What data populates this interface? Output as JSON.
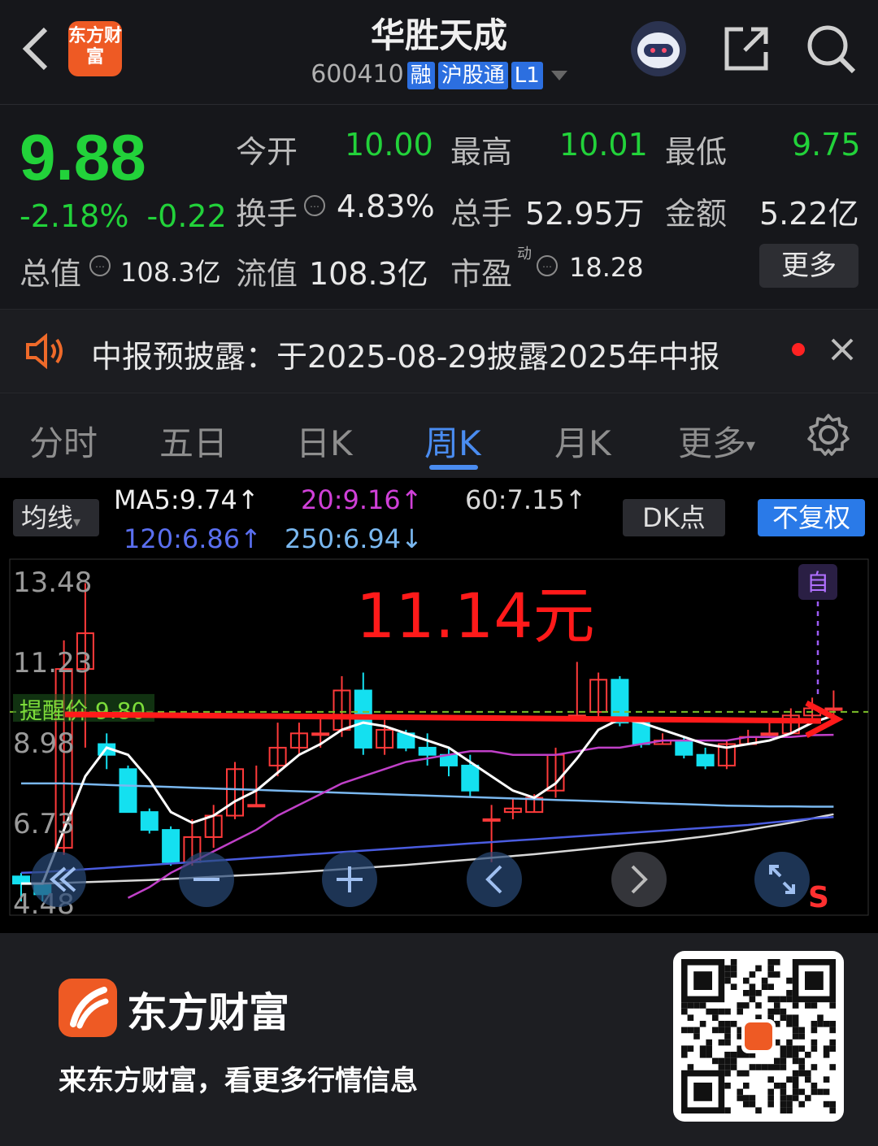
{
  "header": {
    "title": "华胜天成",
    "code": "600410",
    "tags": [
      "融",
      "沪股通",
      "L1"
    ],
    "logo_text": "东方财富"
  },
  "quote": {
    "price": "9.88",
    "change_pct": "-2.18%",
    "change": "-0.22",
    "open_label": "今开",
    "open": "10.00",
    "high_label": "最高",
    "high": "10.01",
    "low_label": "最低",
    "low": "9.75",
    "turnover_label": "换手",
    "turnover": "4.83%",
    "volume_label": "总手",
    "volume": "52.95万",
    "amount_label": "金额",
    "amount": "5.22亿",
    "mktcap_label": "总值",
    "mktcap": "108.3亿",
    "float_label": "流值",
    "float": "108.3亿",
    "pe_label": "市盈",
    "pe_sup": "动",
    "pe": "18.28",
    "more": "更多",
    "up_color": "#ff3030",
    "down_color": "#22d23a"
  },
  "notice": {
    "text": "中报预披露：于2025-08-29披露2025年中报"
  },
  "tabs": [
    "分时",
    "五日",
    "日K",
    "周K",
    "月K",
    "更多"
  ],
  "active_tab": "周K",
  "chart_toolbar": {
    "ma_button": "均线",
    "ma5": "MA5:9.74↑",
    "ma20": "20:9.16↑",
    "ma60": "60:7.15↑",
    "ma120": "120:6.86↑",
    "ma250": "250:6.94↓",
    "dk_button": "DK点",
    "adjust_button": "不复权"
  },
  "chart_data": {
    "type": "candlestick",
    "y_ticks": [
      "13.48",
      "11.23",
      "8.98",
      "6.73",
      "4.48"
    ],
    "ylim": [
      4.48,
      13.48
    ],
    "alert_label": "提醒价 9.80",
    "alert_price": 9.8,
    "annotation": "11.14元",
    "annotation_price": 11.14,
    "self_marker": "自",
    "sell_marker": "S",
    "candles": [
      [
        5.2,
        5.0,
        4.5,
        5.3
      ],
      [
        5.0,
        4.7,
        4.5,
        5.1
      ],
      [
        6.0,
        11.0,
        5.8,
        11.8
      ],
      [
        11.0,
        12.0,
        8.8,
        13.4
      ],
      [
        8.9,
        8.6,
        8.2,
        9.2
      ],
      [
        8.2,
        7.0,
        7.0,
        8.3
      ],
      [
        7.0,
        6.5,
        6.4,
        7.1
      ],
      [
        6.5,
        5.6,
        5.5,
        6.6
      ],
      [
        5.6,
        6.3,
        5.5,
        6.8
      ],
      [
        6.3,
        6.9,
        6.0,
        7.2
      ],
      [
        6.9,
        8.2,
        6.8,
        8.4
      ],
      [
        7.2,
        7.2,
        7.2,
        8.3
      ],
      [
        8.3,
        8.8,
        8.0,
        9.5
      ],
      [
        8.8,
        9.2,
        8.6,
        9.5
      ],
      [
        9.2,
        9.2,
        8.8,
        9.6
      ],
      [
        9.3,
        10.4,
        9.1,
        10.8
      ],
      [
        10.4,
        8.8,
        8.6,
        10.9
      ],
      [
        8.8,
        9.3,
        8.6,
        9.7
      ],
      [
        9.2,
        8.8,
        8.7,
        9.3
      ],
      [
        8.8,
        8.6,
        8.3,
        9.2
      ],
      [
        8.6,
        8.3,
        8.0,
        8.8
      ],
      [
        8.3,
        7.6,
        7.4,
        8.6
      ],
      [
        6.8,
        6.8,
        5.6,
        7.2
      ],
      [
        7.0,
        7.1,
        6.8,
        7.4
      ],
      [
        7.0,
        7.4,
        7.0,
        7.5
      ],
      [
        7.6,
        8.6,
        7.4,
        8.8
      ],
      [
        9.7,
        9.7,
        9.7,
        11.2
      ],
      [
        9.8,
        10.7,
        9.6,
        10.9
      ],
      [
        10.7,
        9.5,
        9.4,
        10.8
      ],
      [
        9.5,
        8.9,
        8.8,
        9.6
      ],
      [
        8.9,
        9.0,
        8.9,
        9.2
      ],
      [
        9.0,
        8.6,
        8.5,
        9.1
      ],
      [
        8.6,
        8.3,
        8.2,
        8.8
      ],
      [
        8.3,
        8.9,
        8.2,
        9.0
      ],
      [
        8.9,
        9.1,
        8.9,
        9.3
      ],
      [
        9.2,
        9.2,
        9.1,
        9.5
      ],
      [
        9.2,
        9.7,
        9.2,
        9.9
      ],
      [
        9.7,
        9.9,
        9.6,
        10.2
      ],
      [
        9.9,
        9.9,
        9.7,
        10.4
      ]
    ],
    "ma5": [
      5.0,
      5.0,
      6.5,
      8.0,
      8.8,
      8.6,
      7.9,
      7.0,
      6.7,
      6.9,
      7.3,
      7.6,
      8.1,
      8.6,
      8.9,
      9.3,
      9.5,
      9.4,
      9.2,
      9.0,
      8.8,
      8.4,
      8.0,
      7.6,
      7.4,
      7.8,
      8.5,
      9.3,
      9.6,
      9.5,
      9.3,
      9.1,
      8.9,
      8.8,
      8.9,
      9.0,
      9.2,
      9.5,
      9.7
    ],
    "ma20": [
      null,
      null,
      null,
      null,
      null,
      4.6,
      4.9,
      5.3,
      5.6,
      5.9,
      6.2,
      6.5,
      6.9,
      7.2,
      7.5,
      7.8,
      8.0,
      8.2,
      8.4,
      8.5,
      8.6,
      8.7,
      8.7,
      8.6,
      8.6,
      8.6,
      8.7,
      8.8,
      8.8,
      8.9,
      9.0,
      9.0,
      9.0,
      9.0,
      9.1,
      9.1,
      9.1,
      9.15,
      9.16
    ],
    "ma60": [
      7.8,
      7.8,
      7.8,
      7.78,
      7.76,
      7.74,
      7.72,
      7.7,
      7.68,
      7.66,
      7.64,
      7.62,
      7.6,
      7.58,
      7.56,
      7.54,
      7.52,
      7.5,
      7.48,
      7.46,
      7.44,
      7.42,
      7.4,
      7.38,
      7.36,
      7.34,
      7.32,
      7.3,
      7.28,
      7.26,
      7.24,
      7.22,
      7.2,
      7.18,
      7.17,
      7.16,
      7.16,
      7.15,
      7.15
    ],
    "ma120": [
      5.3,
      5.32,
      5.36,
      5.4,
      5.44,
      5.48,
      5.52,
      5.56,
      5.6,
      5.64,
      5.68,
      5.72,
      5.76,
      5.8,
      5.84,
      5.88,
      5.92,
      5.96,
      6.0,
      6.04,
      6.08,
      6.12,
      6.16,
      6.2,
      6.24,
      6.28,
      6.32,
      6.36,
      6.4,
      6.44,
      6.48,
      6.52,
      6.56,
      6.6,
      6.64,
      6.7,
      6.76,
      6.82,
      6.86
    ],
    "ma250": [
      5.0,
      5.0,
      5.02,
      5.04,
      5.06,
      5.08,
      5.1,
      5.13,
      5.16,
      5.19,
      5.22,
      5.25,
      5.28,
      5.32,
      5.36,
      5.4,
      5.44,
      5.48,
      5.52,
      5.57,
      5.62,
      5.67,
      5.72,
      5.77,
      5.82,
      5.88,
      5.94,
      6.0,
      6.06,
      6.12,
      6.18,
      6.25,
      6.32,
      6.4,
      6.5,
      6.6,
      6.7,
      6.82,
      6.94
    ],
    "ma_colors": {
      "ma5": "#ffffff",
      "ma20": "#c040c8",
      "ma60": "#7ab8f0",
      "ma120": "#4a5ce0",
      "ma250": "#d8d8d8"
    }
  },
  "chart_controls": [
    "rewind-icon",
    "zoom-out-icon",
    "zoom-in-icon",
    "prev-icon",
    "next-icon",
    "fullscreen-icon"
  ],
  "footer": {
    "brand": "东方财富",
    "slogan": "来东方财富，看更多行情信息"
  }
}
